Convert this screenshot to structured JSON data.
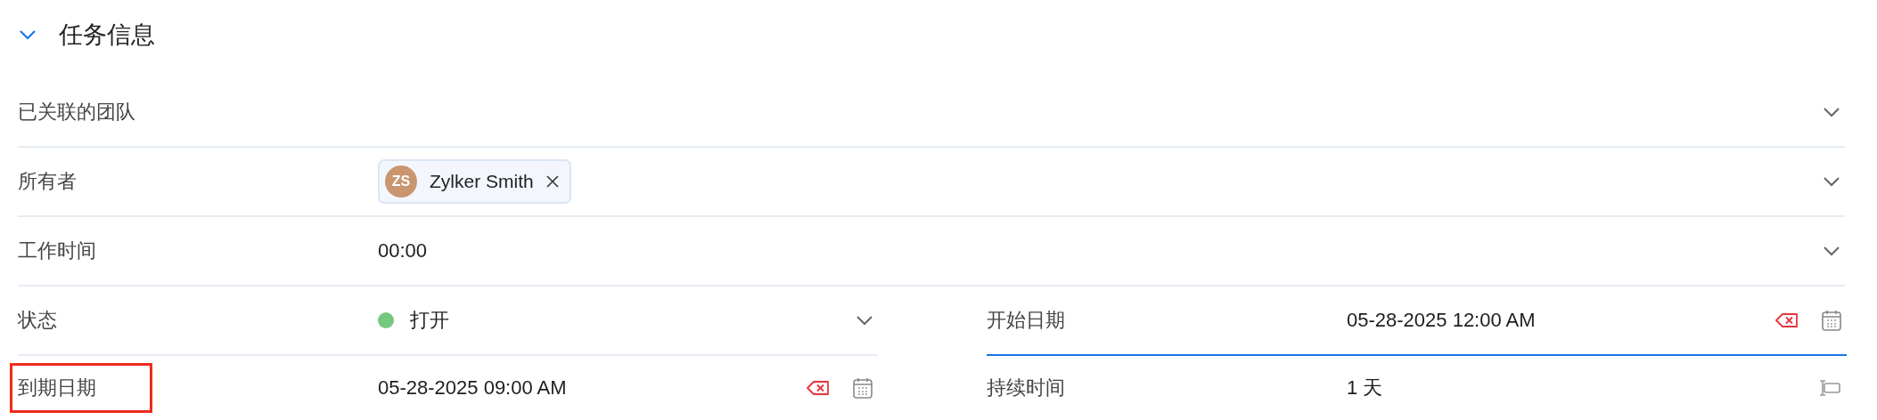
{
  "section": {
    "title": "任务信息",
    "expanded": true
  },
  "rows": [
    {
      "kind": "dropdown",
      "label": "已关联的团队"
    },
    {
      "kind": "owner",
      "label": "所有者",
      "owner": {
        "initials": "ZS",
        "name": "Zylker Smith"
      }
    },
    {
      "kind": "text_dropdown",
      "label": "工作时间",
      "value": "00:00"
    }
  ],
  "split_rows": [
    {
      "left": {
        "kind": "status",
        "label": "状态",
        "value": "打开",
        "color": "#74c97f",
        "focused": false,
        "highlighted": false
      },
      "right": {
        "kind": "date",
        "label": "开始日期",
        "value": "05-28-2025 12:00 AM",
        "focused": true,
        "highlighted": false
      }
    },
    {
      "left": {
        "kind": "date",
        "label": "到期日期",
        "value": "05-28-2025 09:00 AM",
        "focused": false,
        "highlighted": true
      },
      "right": {
        "kind": "duration",
        "label": "持续时间",
        "value": "1 天",
        "focused": false,
        "highlighted": false
      }
    }
  ]
}
